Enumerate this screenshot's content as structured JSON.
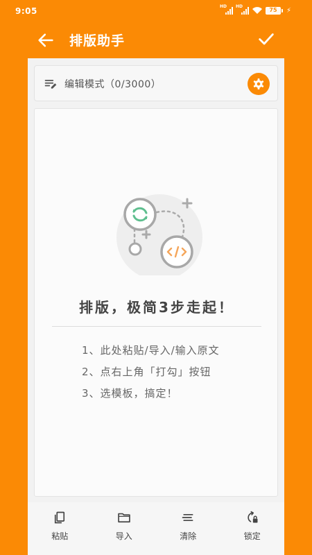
{
  "status_bar": {
    "time": "9:05",
    "network_labels": [
      "HD",
      "HD"
    ],
    "battery": "75"
  },
  "header": {
    "back_icon": "arrow-left-icon",
    "title": "排版助手",
    "confirm_icon": "check-icon"
  },
  "mode_bar": {
    "icon": "edit-notes-icon",
    "label": "编辑模式（0/3000）",
    "settings_icon": "gear-icon"
  },
  "editor": {
    "illustration_icon": "connected-nodes-icon",
    "headline": "排版，极简3步走起！",
    "steps": [
      "1、此处粘贴/导入/输入原文",
      "2、点右上角「打勾」按钮",
      "3、选模板，搞定！"
    ]
  },
  "toolbar": [
    {
      "label": "粘贴",
      "icon": "clipboard-icon"
    },
    {
      "label": "导入",
      "icon": "folder-icon"
    },
    {
      "label": "清除",
      "icon": "clear-lines-icon"
    },
    {
      "label": "锁定",
      "icon": "rotate-lock-icon"
    }
  ],
  "colors": {
    "accent": "#FB8A05",
    "illustration_green": "#5FBF8F",
    "illustration_orange": "#F5A65B"
  }
}
